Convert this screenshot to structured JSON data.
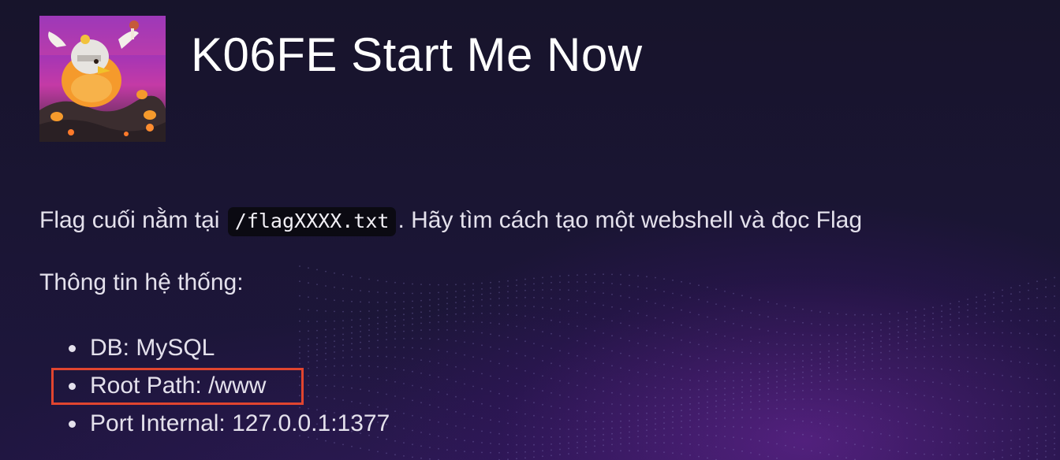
{
  "header": {
    "logo_icon": "chicken-mascot-logo",
    "title": "K06FE Start Me Now"
  },
  "intro": {
    "text_before": "Flag cuối nằm tại ",
    "code": "/flagXXXX.txt",
    "text_after": ". Hãy tìm cách tạo một webshell và đọc Flag"
  },
  "system_info": {
    "heading": "Thông tin hệ thống:",
    "items": [
      {
        "label": "DB: MySQL"
      },
      {
        "label": "Root Path: /www",
        "highlighted": true
      },
      {
        "label": "Port Internal: 127.0.0.1:1377"
      }
    ]
  },
  "colors": {
    "highlight_border": "#e1452f",
    "code_background": "#0b0a12"
  }
}
